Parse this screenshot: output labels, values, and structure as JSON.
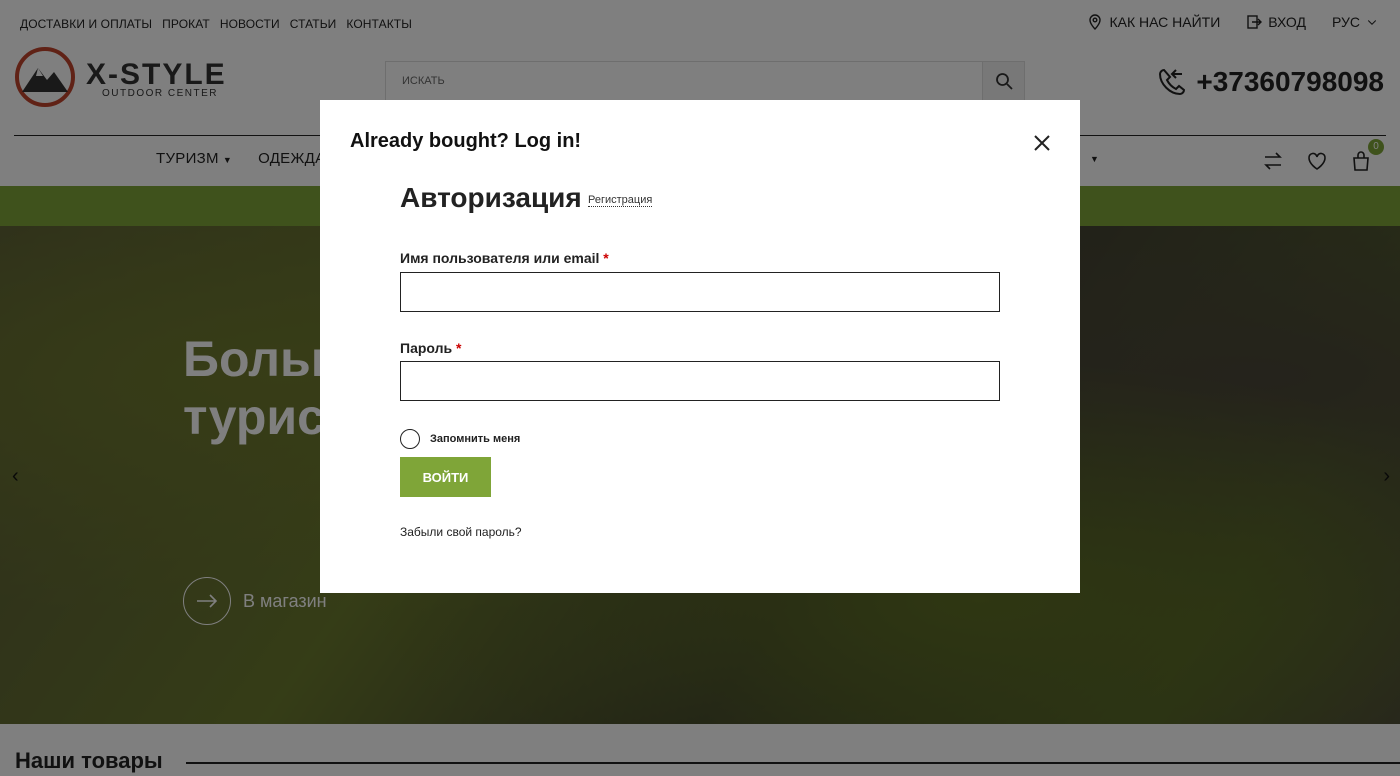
{
  "topbar": {
    "links": [
      "ДОСТАВКИ И ОПЛАТЫ",
      "ПРОКАТ",
      "НОВОСТИ",
      "СТАТЬИ",
      "КОНТАКТЫ"
    ],
    "find_us": "КАК НАС НАЙТИ",
    "login": "ВХОД",
    "language": "РУС"
  },
  "logo": {
    "name": "X-STYLE",
    "sub": "OUTDOOR CENTER"
  },
  "search": {
    "placeholder": "ИСКАТЬ"
  },
  "phone": "+37360798098",
  "nav": {
    "items": [
      "ТУРИЗМ",
      "ОДЕЖДА"
    ]
  },
  "cart": {
    "count": "0"
  },
  "hero": {
    "title": "Больш выбор турист экипи",
    "button": "В магазин"
  },
  "products": {
    "title": "Наши товары"
  },
  "modal": {
    "title": "Already bought? Log in!",
    "auth_title": "Авторизация",
    "register_link": "Регистрация",
    "username_label": "Имя пользователя или email",
    "password_label": "Пароль",
    "required_mark": "*",
    "remember": "Запомнить меня",
    "login_button": "ВОЙТИ",
    "forgot": "Забыли свой пароль?"
  },
  "colors": {
    "accent": "#7fa538",
    "required": "#cc0000"
  }
}
